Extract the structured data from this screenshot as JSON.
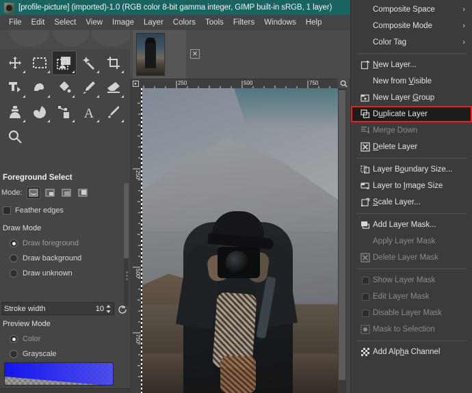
{
  "window": {
    "title": "[profile-picture] (imported)-1.0 (RGB color 8-bit gamma integer, GIMP built-in sRGB, 1 layer)",
    "icon": "gimp-wilber-icon"
  },
  "menubar": {
    "items": [
      {
        "label": "File"
      },
      {
        "label": "Edit"
      },
      {
        "label": "Select"
      },
      {
        "label": "View"
      },
      {
        "label": "Image"
      },
      {
        "label": "Layer"
      },
      {
        "label": "Colors"
      },
      {
        "label": "Tools"
      },
      {
        "label": "Filters"
      },
      {
        "label": "Windows"
      },
      {
        "label": "Help"
      }
    ]
  },
  "toolbox": {
    "tools": [
      {
        "name": "move-tool",
        "active": false
      },
      {
        "name": "rectangle-select-tool",
        "active": false
      },
      {
        "name": "foreground-select-tool",
        "active": true
      },
      {
        "name": "fuzzy-select-tool",
        "active": false
      },
      {
        "name": "crop-tool",
        "active": false
      },
      {
        "name": "transform-tool",
        "active": false
      },
      {
        "name": "warp-transform-tool",
        "active": false
      },
      {
        "name": "bucket-fill-tool",
        "active": false
      },
      {
        "name": "paintbrush-tool",
        "active": false
      },
      {
        "name": "eraser-tool",
        "active": false
      },
      {
        "name": "clone-tool",
        "active": false
      },
      {
        "name": "smudge-tool",
        "active": false
      },
      {
        "name": "paths-tool",
        "active": false
      },
      {
        "name": "text-tool",
        "active": false
      },
      {
        "name": "color-picker-tool",
        "active": false
      },
      {
        "name": "zoom-tool",
        "active": false
      }
    ],
    "colors": {
      "foreground": "#000000",
      "background": "#ffffff"
    },
    "dock_tabs": [
      {
        "name": "device-status-tab",
        "active": false
      },
      {
        "name": "brush-tab",
        "active": false
      },
      {
        "name": "undo-history-tab",
        "active": false
      },
      {
        "name": "images-tab",
        "active": true
      }
    ]
  },
  "tool_options": {
    "title": "Foreground Select",
    "mode_label": "Mode:",
    "modes": [
      {
        "name": "replace-selection",
        "active": true
      },
      {
        "name": "add-to-selection",
        "active": false
      },
      {
        "name": "subtract-from-selection",
        "active": false
      },
      {
        "name": "intersect-with-selection",
        "active": false
      }
    ],
    "feather_edges": {
      "label": "Feather edges",
      "checked": false
    },
    "draw_mode": {
      "label": "Draw Mode",
      "options": [
        {
          "label": "Draw foreground",
          "selected": true
        },
        {
          "label": "Draw background",
          "selected": false
        },
        {
          "label": "Draw unknown",
          "selected": false
        }
      ]
    },
    "stroke_width": {
      "label": "Stroke width",
      "value": "10"
    },
    "preview_mode": {
      "label": "Preview Mode",
      "options": [
        {
          "label": "Color",
          "selected": true
        },
        {
          "label": "Grayscale",
          "selected": false
        }
      ]
    },
    "gradient_color": "#2626f0"
  },
  "image_window": {
    "tab_name": "profile-picture-thumbnail",
    "close_label": "✕",
    "ruler_h_ticks": [
      "250",
      "500",
      "750"
    ],
    "ruler_v_ticks": [
      "250",
      "500",
      "750"
    ],
    "canvas_description": "photographer-with-camera-mountain-background"
  },
  "layer_menu": {
    "items": [
      {
        "label": "Composite Space",
        "icon": "none",
        "submenu": true,
        "disabled": false,
        "mnemonic": ""
      },
      {
        "label": "Composite Mode",
        "icon": "none",
        "submenu": true,
        "disabled": false,
        "mnemonic": ""
      },
      {
        "label": "Color Tag",
        "icon": "none",
        "submenu": true,
        "disabled": false,
        "mnemonic": ""
      },
      {
        "separator": true
      },
      {
        "label": "New Layer...",
        "icon": "new-layer-icon",
        "submenu": false,
        "disabled": false,
        "mnemonic": "N"
      },
      {
        "label": "New from Visible",
        "icon": "none",
        "submenu": false,
        "disabled": false,
        "mnemonic": "V"
      },
      {
        "label": "New Layer Group",
        "icon": "new-layer-group-icon",
        "submenu": false,
        "disabled": false,
        "mnemonic": "G"
      },
      {
        "label": "Duplicate Layer",
        "icon": "duplicate-layer-icon",
        "submenu": false,
        "disabled": false,
        "mnemonic": "u",
        "highlighted": true
      },
      {
        "label": "Merge Down",
        "icon": "merge-down-icon",
        "submenu": false,
        "disabled": true,
        "mnemonic": ""
      },
      {
        "label": "Delete Layer",
        "icon": "delete-layer-icon",
        "submenu": false,
        "disabled": false,
        "mnemonic": "D"
      },
      {
        "separator": true
      },
      {
        "label": "Layer Boundary Size...",
        "icon": "layer-boundary-size-icon",
        "submenu": false,
        "disabled": false,
        "mnemonic": "o"
      },
      {
        "label": "Layer to Image Size",
        "icon": "layer-to-image-size-icon",
        "submenu": false,
        "disabled": false,
        "mnemonic": "I"
      },
      {
        "label": "Scale Layer...",
        "icon": "scale-layer-icon",
        "submenu": false,
        "disabled": false,
        "mnemonic": "S"
      },
      {
        "separator": true
      },
      {
        "label": "Add Layer Mask...",
        "icon": "add-layer-mask-icon",
        "submenu": false,
        "disabled": false,
        "mnemonic": ""
      },
      {
        "label": "Apply Layer Mask",
        "icon": "none",
        "submenu": false,
        "disabled": true,
        "mnemonic": ""
      },
      {
        "label": "Delete Layer Mask",
        "icon": "delete-layer-mask-icon",
        "submenu": false,
        "disabled": true,
        "mnemonic": ""
      },
      {
        "separator": true
      },
      {
        "label": "Show Layer Mask",
        "icon": "checkbox",
        "submenu": false,
        "disabled": true,
        "mnemonic": ""
      },
      {
        "label": "Edit Layer Mask",
        "icon": "checkbox",
        "submenu": false,
        "disabled": true,
        "mnemonic": ""
      },
      {
        "label": "Disable Layer Mask",
        "icon": "checkbox",
        "submenu": false,
        "disabled": true,
        "mnemonic": ""
      },
      {
        "label": "Mask to Selection",
        "icon": "mask-to-selection-icon",
        "submenu": false,
        "disabled": true,
        "mnemonic": ""
      },
      {
        "separator": true
      },
      {
        "label": "Add Alpha Channel",
        "icon": "add-alpha-channel-icon",
        "submenu": false,
        "disabled": false,
        "mnemonic": "h"
      }
    ],
    "submenu_arrow": "›",
    "highlight_color": "#f01f1f"
  }
}
